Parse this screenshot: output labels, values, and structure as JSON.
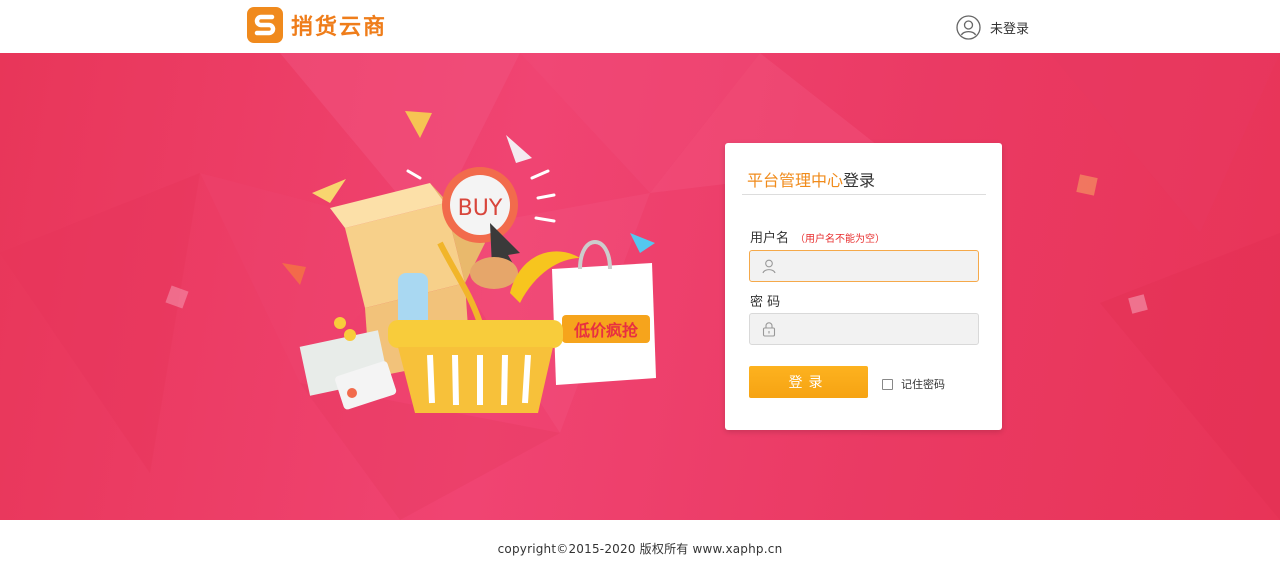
{
  "header": {
    "logo_letter": "S",
    "logo_text": "捎货云商",
    "user_icon": "user-circle-icon",
    "user_status": "未登录"
  },
  "banner": {
    "basket_text": "BUY",
    "sale_tag": "低价疯抢"
  },
  "login": {
    "title_highlight": "平台管理中心",
    "title_rest": "登录",
    "username_label": "用户名",
    "username_hint": "（用户名不能为空）",
    "username_value": "",
    "username_icon": "user-icon",
    "password_label": "密 码",
    "password_value": "",
    "password_icon": "lock-icon",
    "submit_label": "登录",
    "remember_label": "记住密码",
    "remember_checked": false
  },
  "footer": {
    "copyright": "copyright©2015-2020 版权所有 www.xaphp.cn"
  },
  "colors": {
    "brand_orange": "#f08a1d",
    "banner_pink": "#ea3a63",
    "button_yellow": "#f8a816",
    "hint_red": "#e83030"
  }
}
